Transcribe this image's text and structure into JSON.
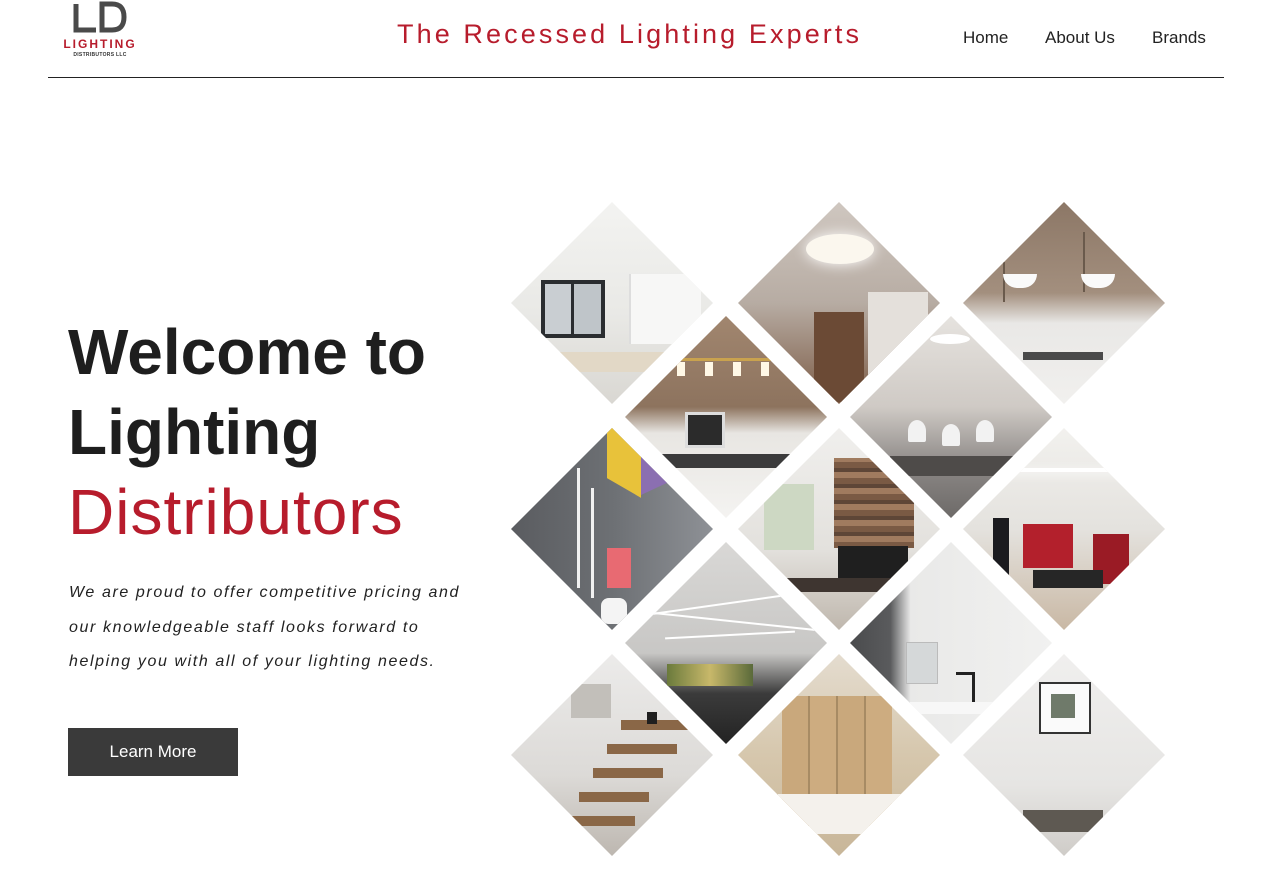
{
  "brand": {
    "logo_mark": "LD",
    "logo_word": "LIGHTING",
    "logo_sub": "DISTRIBUTORS LLC",
    "tagline": "The Recessed Lighting Experts",
    "accent_color": "#b71c2c"
  },
  "nav": {
    "items": [
      {
        "label": "Home"
      },
      {
        "label": "About Us"
      },
      {
        "label": "Brands"
      }
    ]
  },
  "hero": {
    "title_lines": [
      "Welcome to",
      "Lighting",
      "Distributors"
    ],
    "intro_lines": [
      "We are proud to offer competitive pricing and",
      "our knowledgeable staff looks forward to",
      "helping you with all of your lighting needs."
    ],
    "cta_label": "Learn More"
  },
  "collage": {
    "tiles": [
      {
        "name": "white-kitchen-photo"
      },
      {
        "name": "recessed-ceiling-light-photo"
      },
      {
        "name": "pendant-cabinets-photo"
      },
      {
        "name": "kitchen-island-pendants-photo"
      },
      {
        "name": "dining-room-pendants-photo"
      },
      {
        "name": "colorful-bathroom-photo"
      },
      {
        "name": "stone-fireplace-photo"
      },
      {
        "name": "red-kitchen-cove-photo"
      },
      {
        "name": "linear-ceiling-lights-photo"
      },
      {
        "name": "bathroom-mirror-photo"
      },
      {
        "name": "floating-stairs-photo"
      },
      {
        "name": "bedroom-wardrobe-photo"
      },
      {
        "name": "white-wall-art-photo"
      }
    ]
  }
}
